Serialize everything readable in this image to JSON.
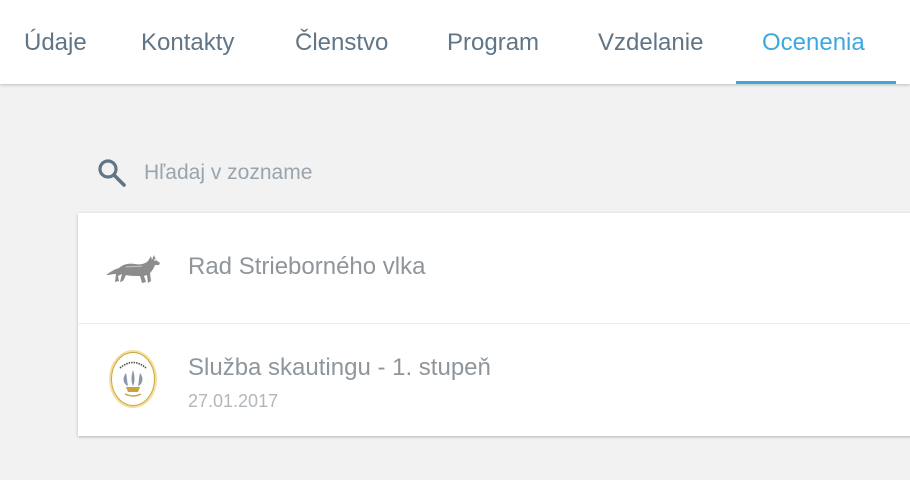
{
  "tabs": [
    {
      "label": "Údaje"
    },
    {
      "label": "Kontakty"
    },
    {
      "label": "Členstvo"
    },
    {
      "label": "Program"
    },
    {
      "label": "Vzdelanie"
    },
    {
      "label": "Ocenenia",
      "active": true
    }
  ],
  "search": {
    "placeholder": "Hľadaj v zozname",
    "value": ""
  },
  "awards": [
    {
      "title": "Rad Strieborného vlka",
      "date": "",
      "icon": "wolf-icon"
    },
    {
      "title": "Služba skautingu - 1. stupeň",
      "date": "27.01.2017",
      "icon": "scouting-service-badge-icon"
    }
  ],
  "colors": {
    "accent": "#3ba9e0",
    "tab_text": "#607585",
    "background": "#f2f2f2",
    "card": "#ffffff",
    "item_text": "#8e969c",
    "date_text": "#b0b8be"
  }
}
